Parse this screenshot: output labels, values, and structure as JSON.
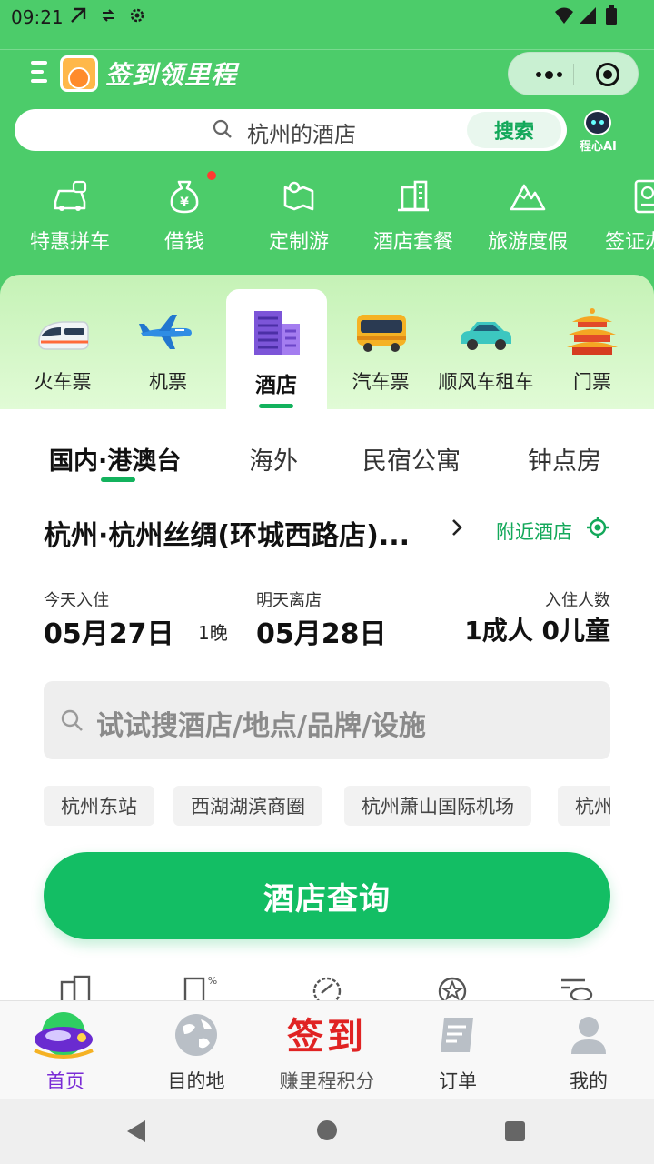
{
  "status_bar": {
    "time": "09:21"
  },
  "header": {
    "title": "签到领里程"
  },
  "top_search": {
    "text": "杭州的酒店",
    "button": "搜索",
    "ai_label": "程心AI"
  },
  "quick_services": [
    {
      "label": "特惠拼车",
      "icon": "car-share-icon"
    },
    {
      "label": "借钱",
      "icon": "money-bag-icon"
    },
    {
      "label": "定制游",
      "icon": "map-icon"
    },
    {
      "label": "酒店套餐",
      "icon": "hotel-building-icon"
    },
    {
      "label": "旅游度假",
      "icon": "mountain-icon"
    },
    {
      "label": "签证办",
      "icon": "passport-icon"
    }
  ],
  "categories": [
    {
      "label": "火车票",
      "icon": "train-icon"
    },
    {
      "label": "机票",
      "icon": "airplane-icon"
    },
    {
      "label": "酒店",
      "icon": "hotel-icon",
      "active": true
    },
    {
      "label": "汽车票",
      "icon": "bus-icon"
    },
    {
      "label": "顺风车租车",
      "icon": "car-icon"
    },
    {
      "label": "门票",
      "icon": "temple-icon"
    }
  ],
  "hotel_tabs": [
    "国内·港澳台",
    "海外",
    "民宿公寓",
    "钟点房"
  ],
  "location": {
    "city": "杭州·杭州丝绸(环城西路店)...",
    "nearby": "附近酒店"
  },
  "dates": {
    "checkin_label": "今天入住",
    "checkin": "05月27日",
    "nights": "1晚",
    "checkout_label": "明天离店",
    "checkout": "05月28日",
    "guests_label": "入住人数",
    "guests": "1成人 0儿童"
  },
  "hotel_search": {
    "placeholder": "试试搜酒店/地点/品牌/设施"
  },
  "chips": [
    "杭州东站",
    "西湖湖滨商圈",
    "杭州萧山国际机场",
    "杭州"
  ],
  "query_button": "酒店查询",
  "bottom_nav": [
    {
      "label": "首页",
      "active": true
    },
    {
      "label": "目的地"
    },
    {
      "label": "赚里程积分",
      "art": "签到"
    },
    {
      "label": "订单"
    },
    {
      "label": "我的"
    }
  ],
  "colors": {
    "brand_green": "#4ccc6a",
    "action_green": "#13be64",
    "active_purple": "#7a2bd6",
    "checkin_red": "#e02323"
  }
}
